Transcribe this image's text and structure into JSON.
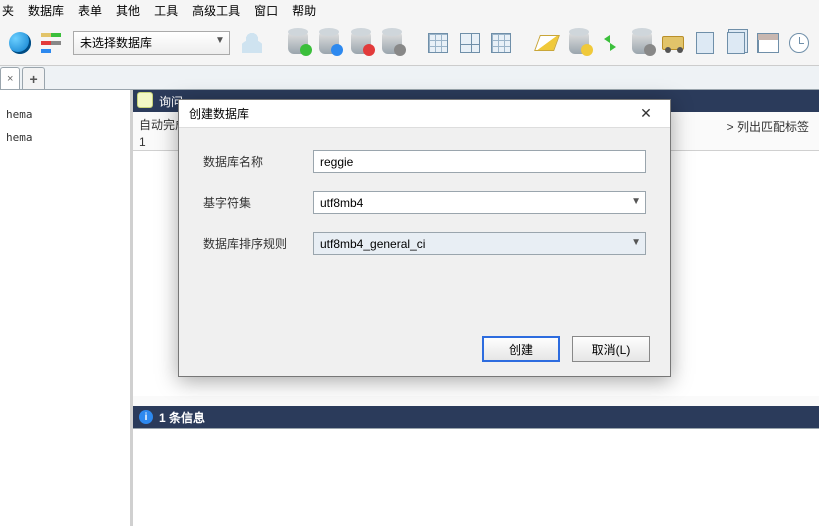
{
  "menu": {
    "items": [
      "夹",
      "数据库",
      "表单",
      "其他",
      "工具",
      "高级工具",
      "窗口",
      "帮助"
    ]
  },
  "toolbar": {
    "db_placeholder": "未选择数据库"
  },
  "tabs": {
    "close_glyph": "×",
    "add_glyph": "+"
  },
  "sidebar": {
    "items": [
      "hema",
      "hema"
    ]
  },
  "query_tab": {
    "title": "询问",
    "autocomplete_line": "自动完成",
    "line_num": "1",
    "match_label": "> 列出匹配标签"
  },
  "messages": {
    "header": "1 条信息",
    "info_glyph": "i"
  },
  "dialog": {
    "title": "创建数据库",
    "close_glyph": "✕",
    "fields": {
      "name_label": "数据库名称",
      "name_value": "reggie",
      "charset_label": "基字符集",
      "charset_value": "utf8mb4",
      "collation_label": "数据库排序规则",
      "collation_value": "utf8mb4_general_ci"
    },
    "create_btn": "创建",
    "cancel_btn": "取消(L)"
  }
}
